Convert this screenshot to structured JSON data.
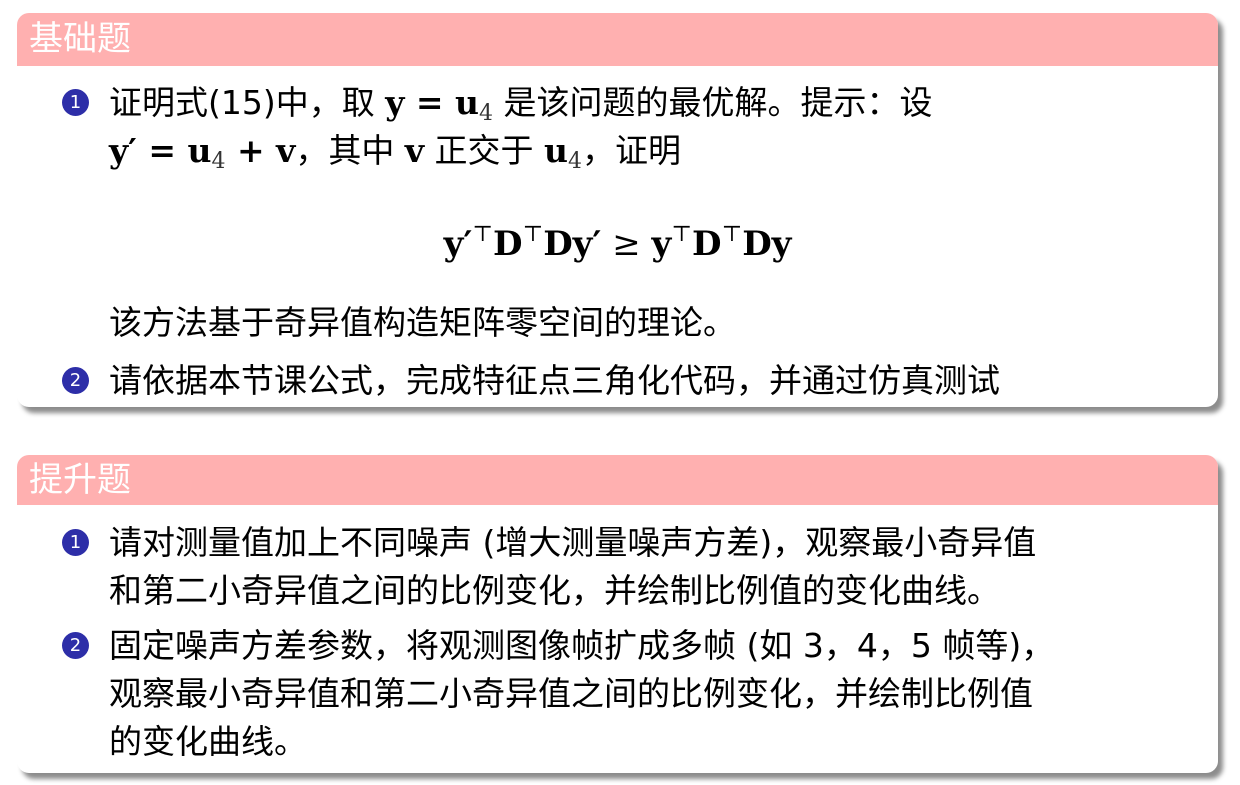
{
  "basic": {
    "title": "基础题",
    "item1": {
      "number": "1",
      "line1_pre": "证明式(15)中，取",
      "line1_math": "y = u",
      "line1_sub": "4",
      "line1_post": "是该问题的最优解。提示：设",
      "line2_math_a": "y′ = u",
      "line2_sub_a": "4",
      "line2_math_b": "+ v",
      "line2_mid": "，其中",
      "line2_v": "v",
      "line2_mid2": "正交于",
      "line2_u": "u",
      "line2_sub_b": "4",
      "line2_post": "，证明",
      "equation": {
        "lhs_a": "y′",
        "T": "⊤",
        "lhs_b": "D",
        "lhs_c": "Dy′",
        "rel": "≥",
        "rhs_a": "y",
        "rhs_b": "D",
        "rhs_c": "Dy"
      },
      "note": "该方法基于奇异值构造矩阵零空间的理论。"
    },
    "item2": {
      "number": "2",
      "text": "请依据本节课公式，完成特征点三角化代码，并通过仿真测试"
    }
  },
  "advanced": {
    "title": "提升题",
    "item1": {
      "number": "1",
      "line1": "请对测量值加上不同噪声 (增大测量噪声方差)，观察最小奇异值",
      "line2": "和第二小奇异值之间的比例变化，并绘制比例值的变化曲线。"
    },
    "item2": {
      "number": "2",
      "line1": "固定噪声方差参数，将观测图像帧扩成多帧 (如 3，4，5 帧等)，",
      "line2": "观察最小奇异值和第二小奇异值之间的比例变化，并绘制比例值",
      "line3": "的变化曲线。"
    }
  },
  "colors": {
    "header_bg": "#ffb0b0",
    "header_text": "#ffffff",
    "bullet_bg": "#2d2ea8"
  }
}
